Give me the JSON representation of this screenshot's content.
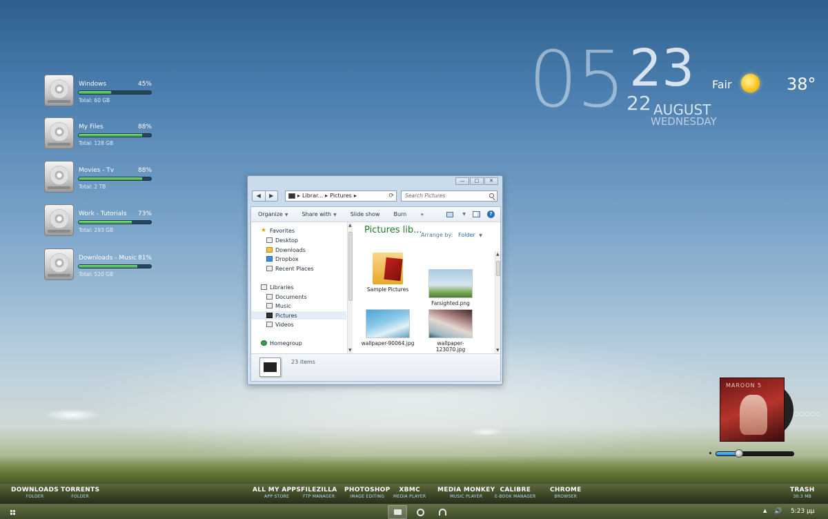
{
  "drives": [
    {
      "name": "Windows",
      "percent": "45%",
      "fill": 0.45,
      "total": "Total: 60 GB"
    },
    {
      "name": "My Files",
      "percent": "88%",
      "fill": 0.88,
      "total": "Total: 128 GB"
    },
    {
      "name": "Movies - Tv",
      "percent": "88%",
      "fill": 0.88,
      "total": "Total: 2 TB"
    },
    {
      "name": "Work - Tutorials",
      "percent": "73%",
      "fill": 0.73,
      "total": "Total: 293 GB"
    },
    {
      "name": "Downloads - Music",
      "percent": "81%",
      "fill": 0.81,
      "total": "Total: 520 GB"
    }
  ],
  "clock": {
    "hour": "05",
    "minute": "23",
    "day": "22",
    "month": "AUGUST",
    "weekday": "WEDNESDAY"
  },
  "weather": {
    "condition": "Fair",
    "temperature": "38°",
    "icon": "sun-icon"
  },
  "explorer": {
    "window_controls": {
      "minimize": "—",
      "maximize": "□",
      "close": "✕"
    },
    "nav": {
      "back": "◀",
      "forward": "▶"
    },
    "address": {
      "crumb1": "Librar...",
      "crumb2": "Pictures",
      "sep": "▸"
    },
    "search": {
      "placeholder": "Search Pictures"
    },
    "toolbar": {
      "organize": "Organize",
      "share_with": "Share with",
      "slide_show": "Slide show",
      "burn": "Burn",
      "more": "»"
    },
    "nav_pane": {
      "favorites": "Favorites",
      "desktop": "Desktop",
      "downloads": "Downloads",
      "dropbox": "Dropbox",
      "recent_places": "Recent Places",
      "libraries": "Libraries",
      "documents": "Documents",
      "music": "Music",
      "pictures": "Pictures",
      "videos": "Videos",
      "homegroup": "Homegroup"
    },
    "library_title": "Pictures lib...",
    "arrange_by_label": "Arrange by:",
    "arrange_by_value": "Folder",
    "files": [
      {
        "name": "Sample Pictures"
      },
      {
        "name": "Farsighted.png"
      },
      {
        "name": "wallpaper-90064.jpg"
      },
      {
        "name": "wallpaper-123070.jpg"
      }
    ],
    "status": {
      "count": "23 items"
    }
  },
  "media": {
    "album_text": "MAROON 5",
    "seek": 0.3,
    "dots": "○○○○○"
  },
  "dock": [
    {
      "label": "DOWNLOADS",
      "sub": "FOLDER"
    },
    {
      "label": "TORRENTS",
      "sub": "FOLDER"
    },
    {
      "label": "ALL MY APPS",
      "sub": "APP STORE"
    },
    {
      "label": "FILEZILLA",
      "sub": "FTP MANAGER"
    },
    {
      "label": "PHOTOSHOP",
      "sub": "IMAGE EDITING"
    },
    {
      "label": "XBMC",
      "sub": "MEDIA PLAYER"
    },
    {
      "label": "MEDIA MONKEY",
      "sub": "MUSIC PLAYER"
    },
    {
      "label": "CALIBRE",
      "sub": "E-BOOK MANAGER"
    },
    {
      "label": "CHROME",
      "sub": "BROWSER"
    },
    {
      "label": "TRASH",
      "sub": "30.3 MB"
    }
  ],
  "taskbar": {
    "tray_arrow": "▲",
    "volume": "🔊",
    "time": "5:23 µµ"
  },
  "colors": {
    "drive_fill": "#3aa544",
    "library_title": "#1f7a2b",
    "seek_fill": "#1b7fd1"
  }
}
